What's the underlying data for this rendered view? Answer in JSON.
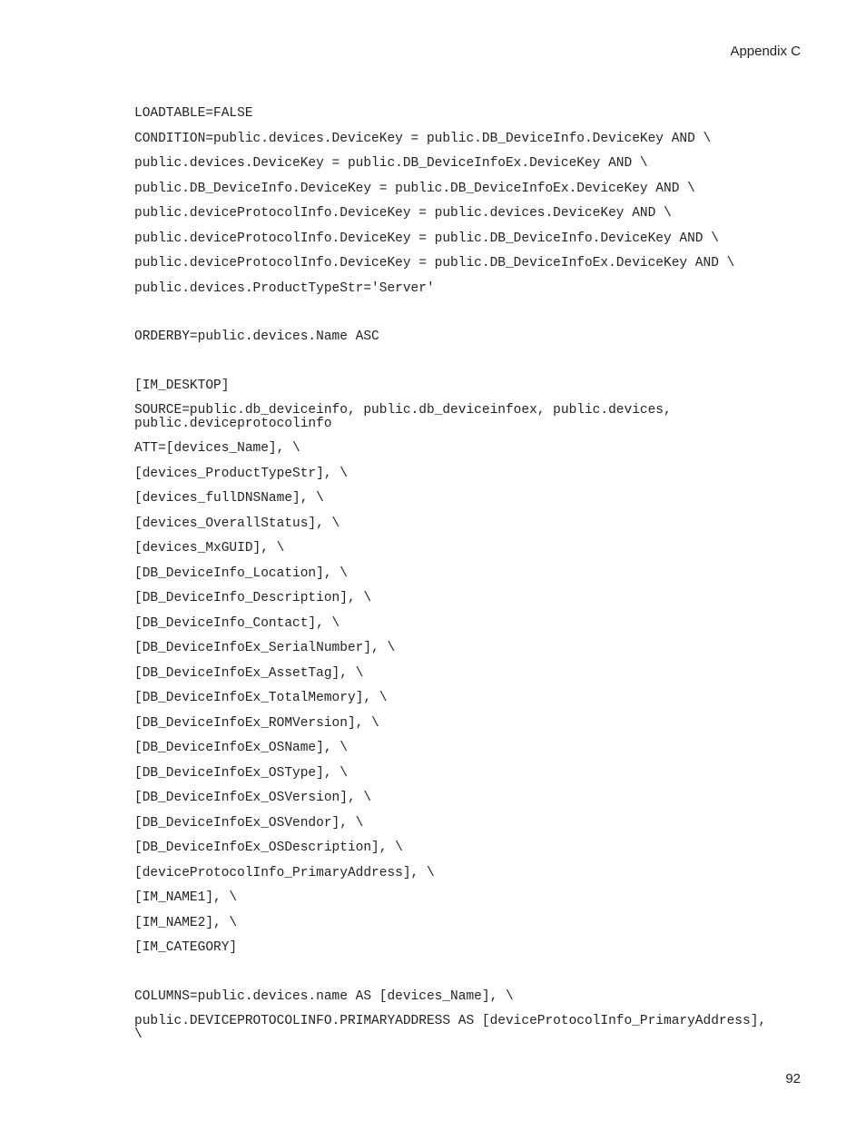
{
  "header": {
    "appendix": "Appendix C"
  },
  "body": {
    "lines": [
      "LOADTABLE=FALSE",
      "CONDITION=public.devices.DeviceKey = public.DB_DeviceInfo.DeviceKey AND \\",
      "public.devices.DeviceKey = public.DB_DeviceInfoEx.DeviceKey AND \\",
      "public.DB_DeviceInfo.DeviceKey = public.DB_DeviceInfoEx.DeviceKey AND \\",
      "public.deviceProtocolInfo.DeviceKey = public.devices.DeviceKey AND \\",
      "public.deviceProtocolInfo.DeviceKey = public.DB_DeviceInfo.DeviceKey AND \\",
      "public.deviceProtocolInfo.DeviceKey = public.DB_DeviceInfoEx.DeviceKey AND \\",
      "public.devices.ProductTypeStr='Server'",
      "",
      "ORDERBY=public.devices.Name ASC",
      "",
      "[IM_DESKTOP]",
      "SOURCE=public.db_deviceinfo, public.db_deviceinfoex, public.devices, public.deviceprotocolinfo",
      "ATT=[devices_Name], \\",
      "[devices_ProductTypeStr], \\",
      "[devices_fullDNSName], \\",
      "[devices_OverallStatus], \\",
      "[devices_MxGUID], \\",
      "[DB_DeviceInfo_Location], \\",
      "[DB_DeviceInfo_Description], \\",
      "[DB_DeviceInfo_Contact], \\",
      "[DB_DeviceInfoEx_SerialNumber], \\",
      "[DB_DeviceInfoEx_AssetTag], \\",
      "[DB_DeviceInfoEx_TotalMemory], \\",
      "[DB_DeviceInfoEx_ROMVersion], \\",
      "[DB_DeviceInfoEx_OSName], \\",
      "[DB_DeviceInfoEx_OSType], \\",
      "[DB_DeviceInfoEx_OSVersion], \\",
      "[DB_DeviceInfoEx_OSVendor], \\",
      "[DB_DeviceInfoEx_OSDescription], \\",
      "[deviceProtocolInfo_PrimaryAddress], \\",
      "[IM_NAME1], \\",
      "[IM_NAME2], \\",
      "[IM_CATEGORY]",
      "",
      "COLUMNS=public.devices.name AS [devices_Name], \\",
      "public.DEVICEPROTOCOLINFO.PRIMARYADDRESS AS [deviceProtocolInfo_PrimaryAddress], \\"
    ]
  },
  "footer": {
    "page_number": "92"
  }
}
